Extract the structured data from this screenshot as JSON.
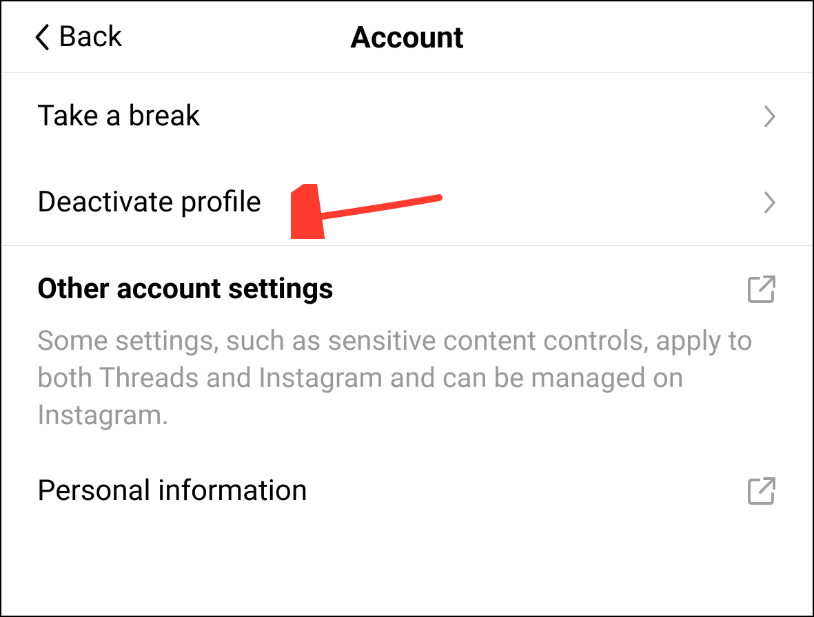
{
  "header": {
    "back_label": "Back",
    "title": "Account"
  },
  "items": [
    {
      "label": "Take a break"
    },
    {
      "label": "Deactivate profile"
    }
  ],
  "other_section": {
    "title": "Other account settings",
    "description": "Some settings, such as sensitive content controls, apply to both Threads and Instagram and can be managed on Instagram."
  },
  "external_items": [
    {
      "label": "Personal information"
    }
  ],
  "annotation": {
    "arrow_color": "#ff3b30"
  }
}
